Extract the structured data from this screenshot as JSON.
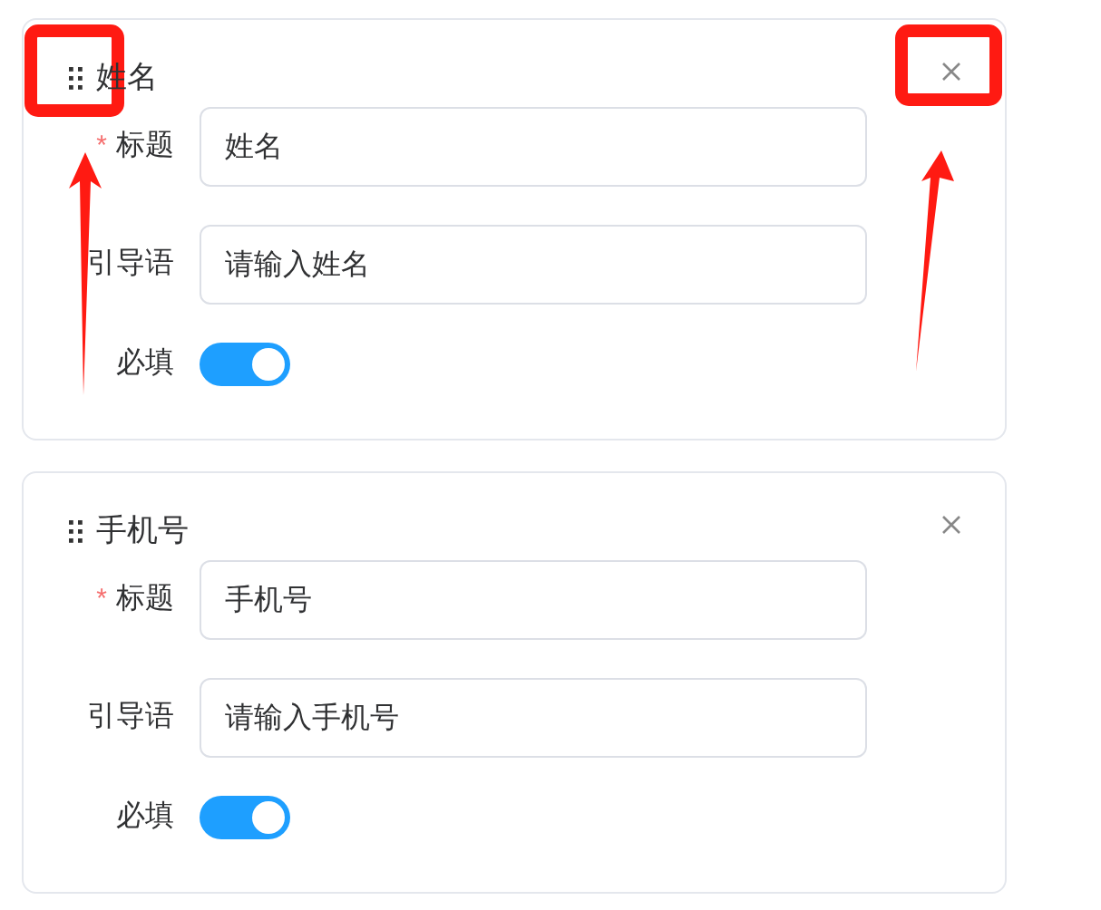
{
  "cards": [
    {
      "title": "姓名",
      "rows": [
        {
          "kind": "input",
          "label": "标题",
          "mark": "*",
          "value": "姓名"
        },
        {
          "kind": "input",
          "label": "引导语",
          "value": "请输入姓名"
        },
        {
          "kind": "switch",
          "label": "必填",
          "on": true
        }
      ]
    },
    {
      "title": "手机号",
      "rows": [
        {
          "kind": "input",
          "label": "标题",
          "mark": "*",
          "value": "手机号"
        },
        {
          "kind": "input",
          "label": "引导语",
          "value": "请输入手机号"
        },
        {
          "kind": "switch",
          "label": "必填",
          "on": true
        }
      ]
    }
  ]
}
